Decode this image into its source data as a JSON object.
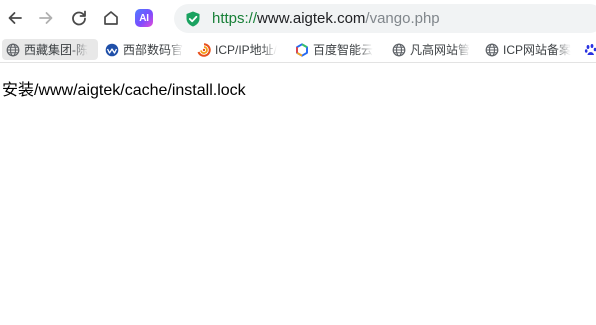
{
  "toolbar": {
    "back_icon": "back-arrow-icon",
    "forward_icon": "forward-arrow-icon",
    "reload_icon": "reload-icon",
    "home_icon": "home-icon",
    "ai_label": "AI"
  },
  "address_bar": {
    "scheme": "https://",
    "host": "www.aigtek.com",
    "path": "/vango.php",
    "secure_icon": "shield-check-icon",
    "secure_color": "#1aa260"
  },
  "bookmarks": [
    {
      "label": "西藏集团-陈",
      "icon": "globe-icon"
    },
    {
      "label": "西部数码官",
      "icon": "west-digital-icon"
    },
    {
      "label": "ICP/IP地址/",
      "icon": "icp-swirl-icon"
    },
    {
      "label": "百度智能云",
      "icon": "baidu-cloud-icon"
    },
    {
      "label": "凡高网站管",
      "icon": "globe-icon"
    },
    {
      "label": "ICP网站备案",
      "icon": "globe-icon"
    },
    {
      "label": "",
      "icon": "baidu-paw-icon"
    }
  ],
  "page": {
    "body_text": "安装/www/aigtek/cache/install.lock"
  }
}
